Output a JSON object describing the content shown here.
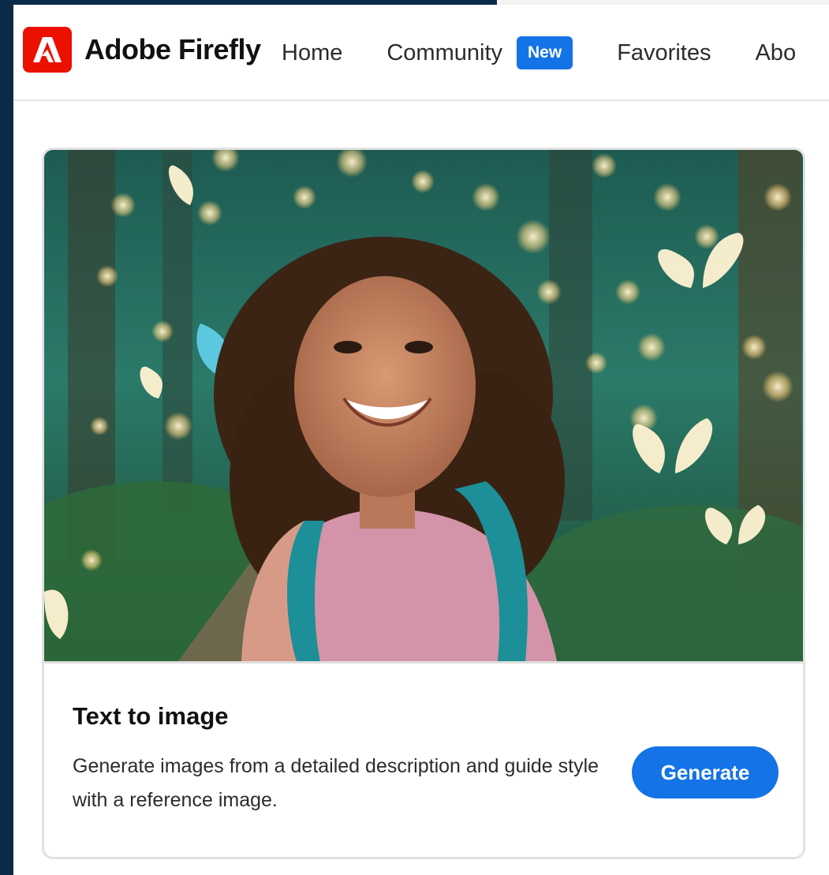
{
  "header": {
    "brand_name": "Adobe Firefly",
    "nav": {
      "home": "Home",
      "community": "Community",
      "new_badge": "New",
      "favorites": "Favorites",
      "about": "Abo"
    }
  },
  "card": {
    "image_icon": "butterfly-forest-image",
    "title": "Text to image",
    "description": "Generate images from a detailed description and guide style with a reference image.",
    "button_label": "Generate"
  },
  "colors": {
    "brand_red": "#eb1000",
    "accent_blue": "#1473e6",
    "backdrop_navy": "#0a2a4a"
  }
}
